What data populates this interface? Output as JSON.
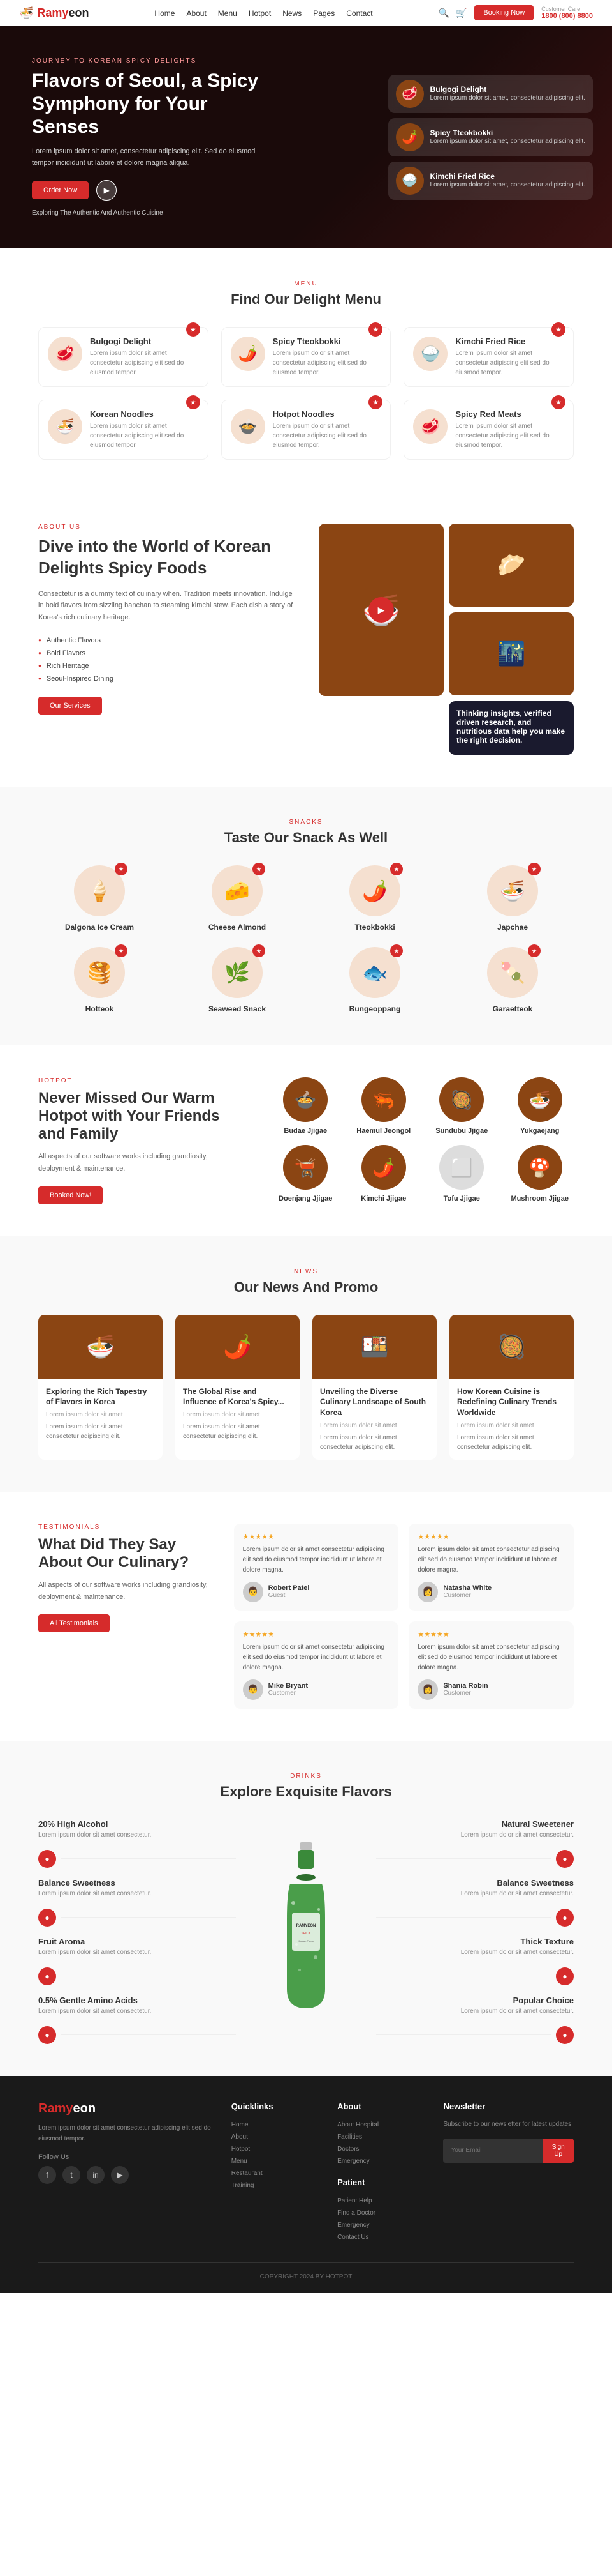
{
  "brand": {
    "name": "Ramy",
    "name2": "eon",
    "logo_emoji": "🍜"
  },
  "nav": {
    "links": [
      "Home",
      "About",
      "Menu",
      "Hotpot",
      "News",
      "Pages",
      "Contact"
    ],
    "booking_label": "Booking Now",
    "phone": "Customer Care",
    "phone_number": "1800 (800) 8800",
    "search_icon": "🔍",
    "cart_icon": "🛒"
  },
  "hero": {
    "tag": "JOURNEY TO KOREAN SPICY DELIGHTS",
    "title": "Flavors of Seoul, a Spicy Symphony for Your Senses",
    "desc": "Lorem ipsum dolor sit amet, consectetur adipiscing elit. Sed do eiusmod tempor incididunt ut labore et dolore magna aliqua.",
    "btn_order": "Order Now",
    "btn_scroll": "Exploring The Authentic And Authentic Cuisine",
    "cards": [
      {
        "name": "Bulgogi Delight",
        "desc": "Lorem ipsum dolor sit amet, consectetur adipiscing elit.",
        "emoji": "🥩"
      },
      {
        "name": "Spicy Tteokbokki",
        "desc": "Lorem ipsum dolor sit amet, consectetur adipiscing elit.",
        "emoji": "🌶️"
      },
      {
        "name": "Kimchi Fried Rice",
        "desc": "Lorem ipsum dolor sit amet, consectetur adipiscing elit.",
        "emoji": "🍚"
      }
    ]
  },
  "menu_section": {
    "tag": "MENU",
    "title": "Find Our Delight Menu",
    "items": [
      {
        "name": "Bulgogi Delight",
        "desc": "Lorem ipsum dolor sit amet consectetur adipiscing elit sed do eiusmod tempor.",
        "emoji": "🥩",
        "badge": "★"
      },
      {
        "name": "Spicy Tteokbokki",
        "desc": "Lorem ipsum dolor sit amet consectetur adipiscing elit sed do eiusmod tempor.",
        "emoji": "🌶️",
        "badge": "★"
      },
      {
        "name": "Kimchi Fried Rice",
        "desc": "Lorem ipsum dolor sit amet consectetur adipiscing elit sed do eiusmod tempor.",
        "emoji": "🍚",
        "badge": "★"
      },
      {
        "name": "Korean Noodles",
        "desc": "Lorem ipsum dolor sit amet consectetur adipiscing elit sed do eiusmod tempor.",
        "emoji": "🍜",
        "badge": "★"
      },
      {
        "name": "Hotpot Noodles",
        "desc": "Lorem ipsum dolor sit amet consectetur adipiscing elit sed do eiusmod tempor.",
        "emoji": "🍲",
        "badge": "★"
      },
      {
        "name": "Spicy Red Meats",
        "desc": "Lorem ipsum dolor sit amet consectetur adipiscing elit sed do eiusmod tempor.",
        "emoji": "🥩",
        "badge": "★"
      }
    ]
  },
  "about_section": {
    "tag": "ABOUT US",
    "title": "Dive into the World of Korean Delights Spicy Foods",
    "desc": "Consectetur is a dummy text of culinary when. Tradition meets innovation. Indulge in bold flavors from sizzling banchan to steaming kimchi stew. Each dish a story of Korea's rich culinary heritage.",
    "features": [
      "Authentic Flavors",
      "Bold Flavors",
      "Rich Heritage",
      "Seoul-Inspired Dining"
    ],
    "btn": "Our Services",
    "info_card_title": "Thinking insights, verified driven research, and nutritious data help you make the right decision.",
    "info_card_dot": "▶"
  },
  "snacks_section": {
    "tag": "SNACKS",
    "title": "Taste Our Snack As Well",
    "items": [
      {
        "name": "Dalgona Ice Cream",
        "emoji": "🍦",
        "badge": "★"
      },
      {
        "name": "Cheese Almond",
        "emoji": "🧀",
        "badge": "★"
      },
      {
        "name": "Tteokbokki",
        "emoji": "🌶️",
        "badge": "★"
      },
      {
        "name": "Japchae",
        "emoji": "🍜",
        "badge": "★"
      },
      {
        "name": "Hotteok",
        "emoji": "🥞",
        "badge": "★"
      },
      {
        "name": "Seaweed Snack",
        "emoji": "🌿",
        "badge": "★"
      },
      {
        "name": "Bungeoppang",
        "emoji": "🐟",
        "badge": "★"
      },
      {
        "name": "Garaetteok",
        "emoji": "🍡",
        "badge": "★"
      }
    ]
  },
  "hotpot_section": {
    "tag": "HOTPOT",
    "title": "Never Missed Our Warm Hotpot with Your Friends and Family",
    "desc": "All aspects of our software works including grandiosity, deployment & maintenance.",
    "btn": "Booked Now!",
    "items": [
      {
        "name": "Budae Jjigae",
        "emoji": "🍲"
      },
      {
        "name": "Haemul Jeongol",
        "emoji": "🦐"
      },
      {
        "name": "Sundubu Jjigae",
        "emoji": "🥘"
      },
      {
        "name": "Yukgaejang",
        "emoji": "🍜"
      },
      {
        "name": "Doenjang Jjigae",
        "emoji": "🫕"
      },
      {
        "name": "Kimchi Jjigae",
        "emoji": "🌶️"
      },
      {
        "name": "Tofu Jjigae",
        "emoji": "⬜"
      },
      {
        "name": "Mushroom Jjigae",
        "emoji": "🍄"
      }
    ]
  },
  "news_section": {
    "tag": "NEWS",
    "title": "Our News And Promo",
    "items": [
      {
        "title": "Exploring the Rich Tapestry of Flavors in Korea",
        "meta": "Lorem ipsum dolor sit amet",
        "desc": "Lorem ipsum dolor sit amet consectetur adipiscing elit.",
        "emoji": "🍜"
      },
      {
        "title": "The Global Rise and Influence of Korea's Spicy...",
        "meta": "Lorem ipsum dolor sit amet",
        "desc": "Lorem ipsum dolor sit amet consectetur adipiscing elit.",
        "emoji": "🌶️"
      },
      {
        "title": "Unveiling the Diverse Culinary Landscape of South Korea",
        "meta": "Lorem ipsum dolor sit amet",
        "desc": "Lorem ipsum dolor sit amet consectetur adipiscing elit.",
        "emoji": "🍱"
      },
      {
        "title": "How Korean Cuisine is Redefining Culinary Trends Worldwide",
        "meta": "Lorem ipsum dolor sit amet",
        "desc": "Lorem ipsum dolor sit amet consectetur adipiscing elit.",
        "emoji": "🥘"
      }
    ]
  },
  "testimonials_section": {
    "tag": "TESTIMONIALS",
    "title": "What Did They Say About Our Culinary?",
    "desc": "All aspects of our software works including grandiosity, deployment & maintenance.",
    "btn": "All Testimonials",
    "items": [
      {
        "text": "Lorem ipsum dolor sit amet consectetur adipiscing elit sed do eiusmod tempor incididunt ut labore et dolore magna.",
        "name": "Robert Patel",
        "role": "Guest",
        "avatar": "👨",
        "stars": "★★★★★"
      },
      {
        "text": "Lorem ipsum dolor sit amet consectetur adipiscing elit sed do eiusmod tempor incididunt ut labore et dolore magna.",
        "name": "Natasha White",
        "role": "Customer",
        "avatar": "👩",
        "stars": "★★★★★"
      },
      {
        "text": "Lorem ipsum dolor sit amet consectetur adipiscing elit sed do eiusmod tempor incididunt ut labore et dolore magna.",
        "name": "Mike Bryant",
        "role": "Customer",
        "avatar": "👨",
        "stars": "★★★★★"
      },
      {
        "text": "Lorem ipsum dolor sit amet consectetur adipiscing elit sed do eiusmod tempor incididunt ut labore et dolore magna.",
        "name": "Shania Robin",
        "role": "Customer",
        "avatar": "👩",
        "stars": "★★★★★"
      }
    ]
  },
  "flavors_section": {
    "tag": "DRINKS",
    "title": "Explore Exquisite Flavors",
    "left_items": [
      {
        "name": "20% High Alcohol",
        "desc": "Lorem ipsum dolor sit amet consectetur."
      },
      {
        "name": "Balance Sweetness",
        "desc": "Lorem ipsum dolor sit amet consectetur."
      },
      {
        "name": "Fruit Aroma",
        "desc": "Lorem ipsum dolor sit amet consectetur."
      },
      {
        "name": "0.5% Gentle Amino Acids",
        "desc": "Lorem ipsum dolor sit amet consectetur."
      }
    ],
    "right_items": [
      {
        "name": "Natural Sweetener",
        "desc": "Lorem ipsum dolor sit amet consectetur."
      },
      {
        "name": "Balance Sweetness",
        "desc": "Lorem ipsum dolor sit amet consectetur."
      },
      {
        "name": "Thick Texture",
        "desc": "Lorem ipsum dolor sit amet consectetur."
      },
      {
        "name": "Popular Choice",
        "desc": "Lorem ipsum dolor sit amet consectetur."
      }
    ]
  },
  "footer": {
    "desc": "Lorem ipsum dolor sit amet consectetur adipiscing elit sed do eiusmod tempor.",
    "social": [
      "f",
      "t",
      "in",
      "yt"
    ],
    "quicklinks_title": "Quicklinks",
    "quicklinks": [
      "Home",
      "About",
      "Hotpot",
      "Menu",
      "Restaurant",
      "Training"
    ],
    "about_title": "About",
    "about_links": [
      "About Hospital",
      "Facilities",
      "Doctors",
      "Emergency"
    ],
    "patient_title": "Patient",
    "patient_links": [
      "Patient Help",
      "Find a Doctor",
      "Emergency",
      "Contact Us"
    ],
    "newsletter_title": "Newsletter",
    "newsletter_desc": "Subscribe to our newsletter for latest updates.",
    "newsletter_placeholder": "Your Email",
    "newsletter_btn": "Sign Up",
    "copyright": "COPYRIGHT 2024 BY HOTPOT"
  }
}
